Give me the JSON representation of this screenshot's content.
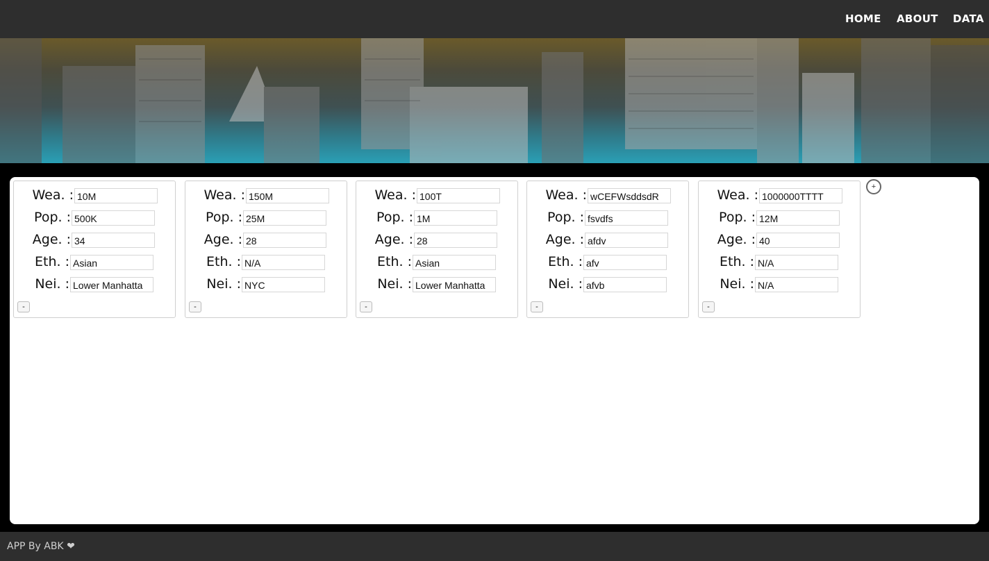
{
  "nav": {
    "items": [
      {
        "label": "HOME"
      },
      {
        "label": "ABOUT"
      },
      {
        "label": "DATA"
      }
    ]
  },
  "labels": {
    "wealth": "Wea. :",
    "population": "Pop. :",
    "age": "Age. :",
    "ethnicity": "Eth. :",
    "neighborhood": "Nei. :"
  },
  "cards": [
    {
      "wealth": "10M",
      "population": "500K",
      "age": "34",
      "ethnicity": "Asian",
      "neighborhood": "Lower Manhatta"
    },
    {
      "wealth": "150M",
      "population": "25M",
      "age": "28",
      "ethnicity": "N/A",
      "neighborhood": "NYC"
    },
    {
      "wealth": "100T",
      "population": "1M",
      "age": "28",
      "ethnicity": "Asian",
      "neighborhood": "Lower Manhatta"
    },
    {
      "wealth": "wCEFWsddsdR",
      "population": "fsvdfs",
      "age": "afdv",
      "ethnicity": "afv",
      "neighborhood": "afvb"
    },
    {
      "wealth": "1000000TTTT",
      "population": "12M",
      "age": "40",
      "ethnicity": "N/A",
      "neighborhood": "N/A"
    }
  ],
  "buttons": {
    "remove_label": "-",
    "add_label": "+"
  },
  "footer": {
    "text": "APP By ABK ❤"
  },
  "colors": {
    "navbar": "#2e2e2e",
    "hero_top": "#6a5a2a",
    "hero_bottom": "#2a9fb5"
  }
}
